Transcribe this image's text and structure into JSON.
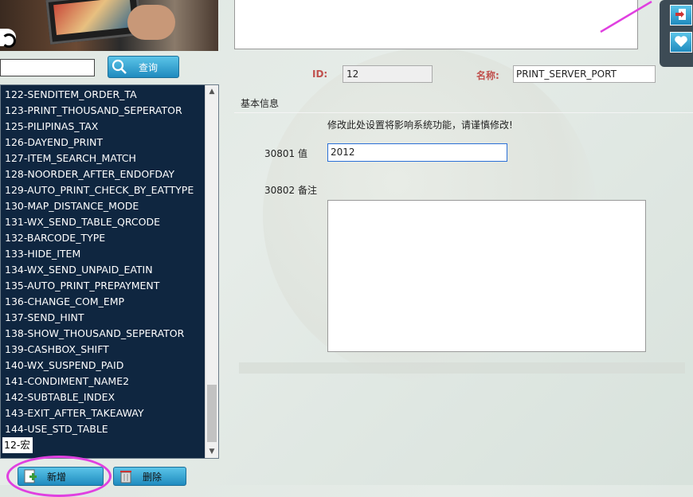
{
  "search": {
    "input_value": "",
    "button_label": "查询"
  },
  "list": {
    "items": [
      "122-SENDITEM_ORDER_TA",
      "123-PRINT_THOUSAND_SEPERATOR",
      "125-PILIPINAS_TAX",
      "126-DAYEND_PRINT",
      "127-ITEM_SEARCH_MATCH",
      "128-NOORDER_AFTER_ENDOFDAY",
      "129-AUTO_PRINT_CHECK_BY_EATTYPE",
      "130-MAP_DISTANCE_MODE",
      "131-WX_SEND_TABLE_QRCODE",
      "132-BARCODE_TYPE",
      "133-HIDE_ITEM",
      "134-WX_SEND_UNPAID_EATIN",
      "135-AUTO_PRINT_PREPAYMENT",
      "136-CHANGE_COM_EMP",
      "137-SEND_HINT",
      "138-SHOW_THOUSAND_SEPERATOR",
      "139-CASHBOX_SHIFT",
      "140-WX_SUSPEND_PAID",
      "141-CONDIMENT_NAME2",
      "142-SUBTABLE_INDEX",
      "143-EXIT_AFTER_TAKEAWAY",
      "144-USE_STD_TABLE"
    ],
    "selected": "12-宏"
  },
  "buttons": {
    "add_label": "新增",
    "delete_label": "删除"
  },
  "form": {
    "id_label": "ID:",
    "id_value": "12",
    "name_label": "名称:",
    "name_value": "PRINT_SERVER_PORT",
    "section_title": "基本信息",
    "warning": "修改此处设置将影响系统功能，请谨慎修改!",
    "field1_label": "30801 值",
    "field1_value": "2012",
    "field2_label": "30802 备注",
    "field2_value": ""
  },
  "icons": {
    "search": "magnifier-icon",
    "add": "add-document-icon",
    "delete": "trash-icon",
    "exit": "exit-door-icon",
    "favorite": "heart-icon"
  },
  "colors": {
    "list_bg": "#0f2640",
    "button_blue": "#1f8bbf",
    "label_red": "#c0504d",
    "annotation": "#e040e0"
  }
}
